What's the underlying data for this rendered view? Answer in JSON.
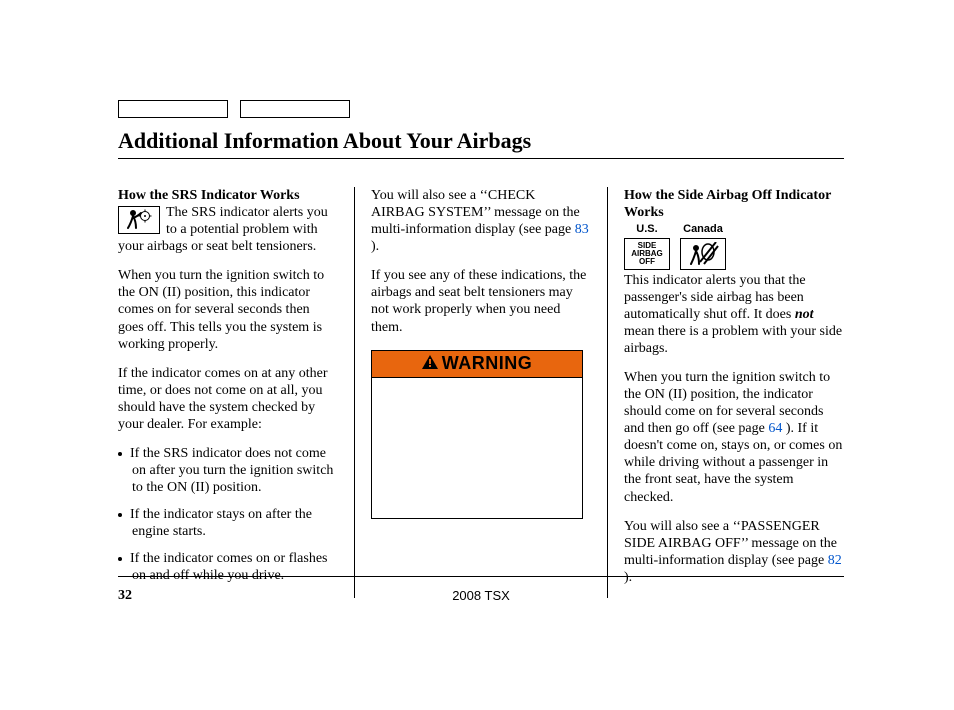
{
  "title": "Additional Information About Your Airbags",
  "col1": {
    "heading": "How the SRS Indicator Works",
    "intro": "The SRS indicator alerts you to a potential problem with your airbags or seat belt tensioners.",
    "p2": "When you turn the ignition switch to the ON (II) position, this indicator comes on for several seconds then goes off. This tells you the system is working properly.",
    "p3": "If the indicator comes on at any other time, or does not come on at all, you should have the system checked by your dealer. For example:",
    "bullets": [
      "If the SRS indicator does not come on after you turn the ignition switch to the ON (II) position.",
      "If the indicator stays on after the engine starts.",
      "If the indicator comes on or flashes on and off while you drive."
    ]
  },
  "col2": {
    "p1a": "You will also see a ‘‘CHECK AIRBAG SYSTEM’’ message on the multi-information display (see page ",
    "p1link": "83",
    "p1b": " ).",
    "p2": "If you see any of these indications, the airbags and seat belt tensioners may not work properly when you need them.",
    "warning_label": "WARNING"
  },
  "col3": {
    "heading": "How the Side Airbag Off Indicator Works",
    "us_label": "U.S.",
    "ca_label": "Canada",
    "us_box_l1": "SIDE",
    "us_box_l2": "AIRBAG",
    "us_box_l3": "OFF",
    "p1a": "This indicator alerts you that the passenger's side airbag has been automatically shut off. It does ",
    "p1em": "not",
    "p1b": " mean there is a problem with your side airbags.",
    "p2a": "When you turn the ignition switch to the ON (II) position, the indicator should come on for several seconds and then go off (see page ",
    "p2link": "64",
    "p2b": " ). If it doesn't come on, stays on, or comes on while driving without a passenger in the front seat, have the system checked.",
    "p3a": "You will also see a ‘‘PASSENGER SIDE AIRBAG OFF’’ message on the multi-information display (see page ",
    "p3link": "82",
    "p3b": "  )."
  },
  "footer": {
    "page": "32",
    "model": "2008 TSX"
  }
}
